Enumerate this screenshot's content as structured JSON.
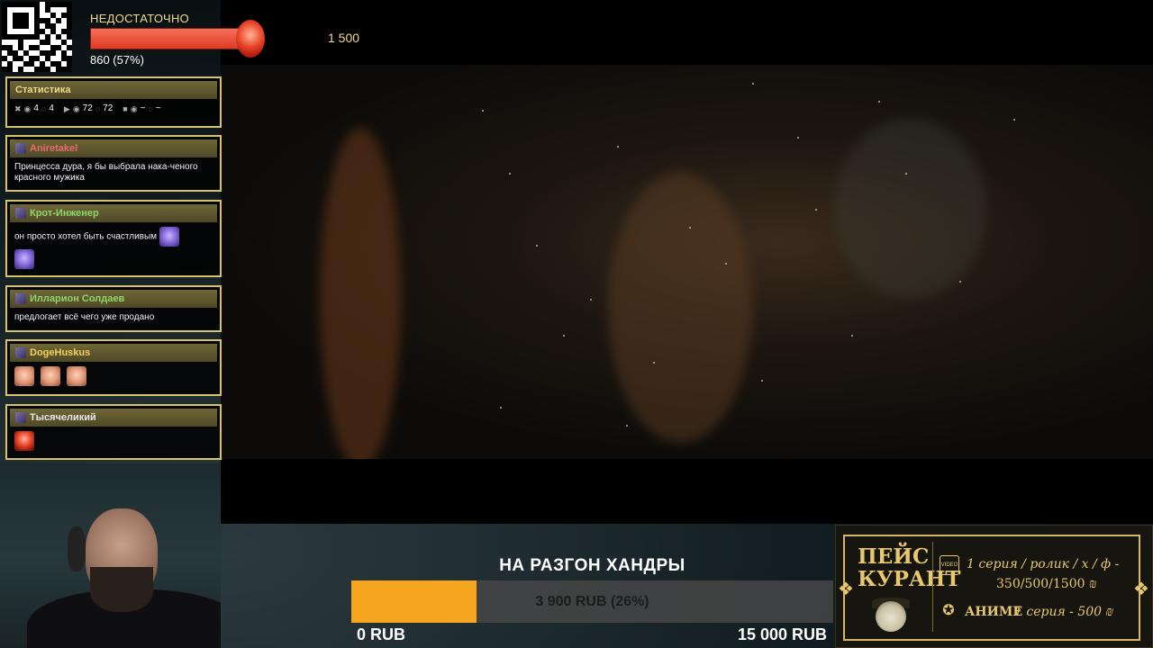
{
  "alert": {
    "label": "НЕДОСТАТОЧНО",
    "current": "860 (57%)",
    "target": "1 500",
    "progress_percent": 57
  },
  "chat": {
    "stats": {
      "title": "Статистика",
      "items": [
        "4",
        "4",
        "72",
        "72",
        "~",
        "~"
      ]
    },
    "messages": [
      {
        "user": "Aniretakel",
        "color": "#e86a6a",
        "text": "Принцесса дура, я бы выбрала нака-ченого красного мужика",
        "emotes": []
      },
      {
        "user": "Крот-Инженер",
        "color": "#8cd86a",
        "text": "он просто хотел быть счастливым",
        "emotes": [
          "purple",
          "purple"
        ]
      },
      {
        "user": "Илларион Солдаев",
        "color": "#8cd86a",
        "text": "предлогает всё чего уже продано",
        "emotes": []
      },
      {
        "user": "DogeHuskus",
        "color": "#f2d15c",
        "text": "",
        "emotes": [
          "face",
          "face",
          "face"
        ]
      },
      {
        "user": "Тысячеликий",
        "color": "#e6e6e6",
        "text": "",
        "emotes": [
          "red"
        ]
      }
    ]
  },
  "goal": {
    "title": "НА РАЗГОН ХАНДРЫ",
    "progress_text": "3 900 RUB (26%)",
    "progress_percent": 26,
    "min": "0 RUB",
    "max": "15 000 RUB"
  },
  "price": {
    "title_line1": "ПЕЙС",
    "title_line2": "КУРАНТ",
    "row1": "1 серия / ролик / х / ф -",
    "row1b": "350/500/1500 ₪",
    "row2_label": "АНИМЕ",
    "row2": "1 серия - 500 ₪",
    "icon_video_text": "VIDEO"
  },
  "colors": {
    "accent_gold": "#d8c36a",
    "goal_fill": "#f6a51f",
    "alert_bar": "#e03a22"
  },
  "icons": [
    "qr-code-icon",
    "close-icon",
    "eye-icon",
    "chat-icon",
    "play-icon",
    "video-icon",
    "spy-icon",
    "anime-icon"
  ]
}
